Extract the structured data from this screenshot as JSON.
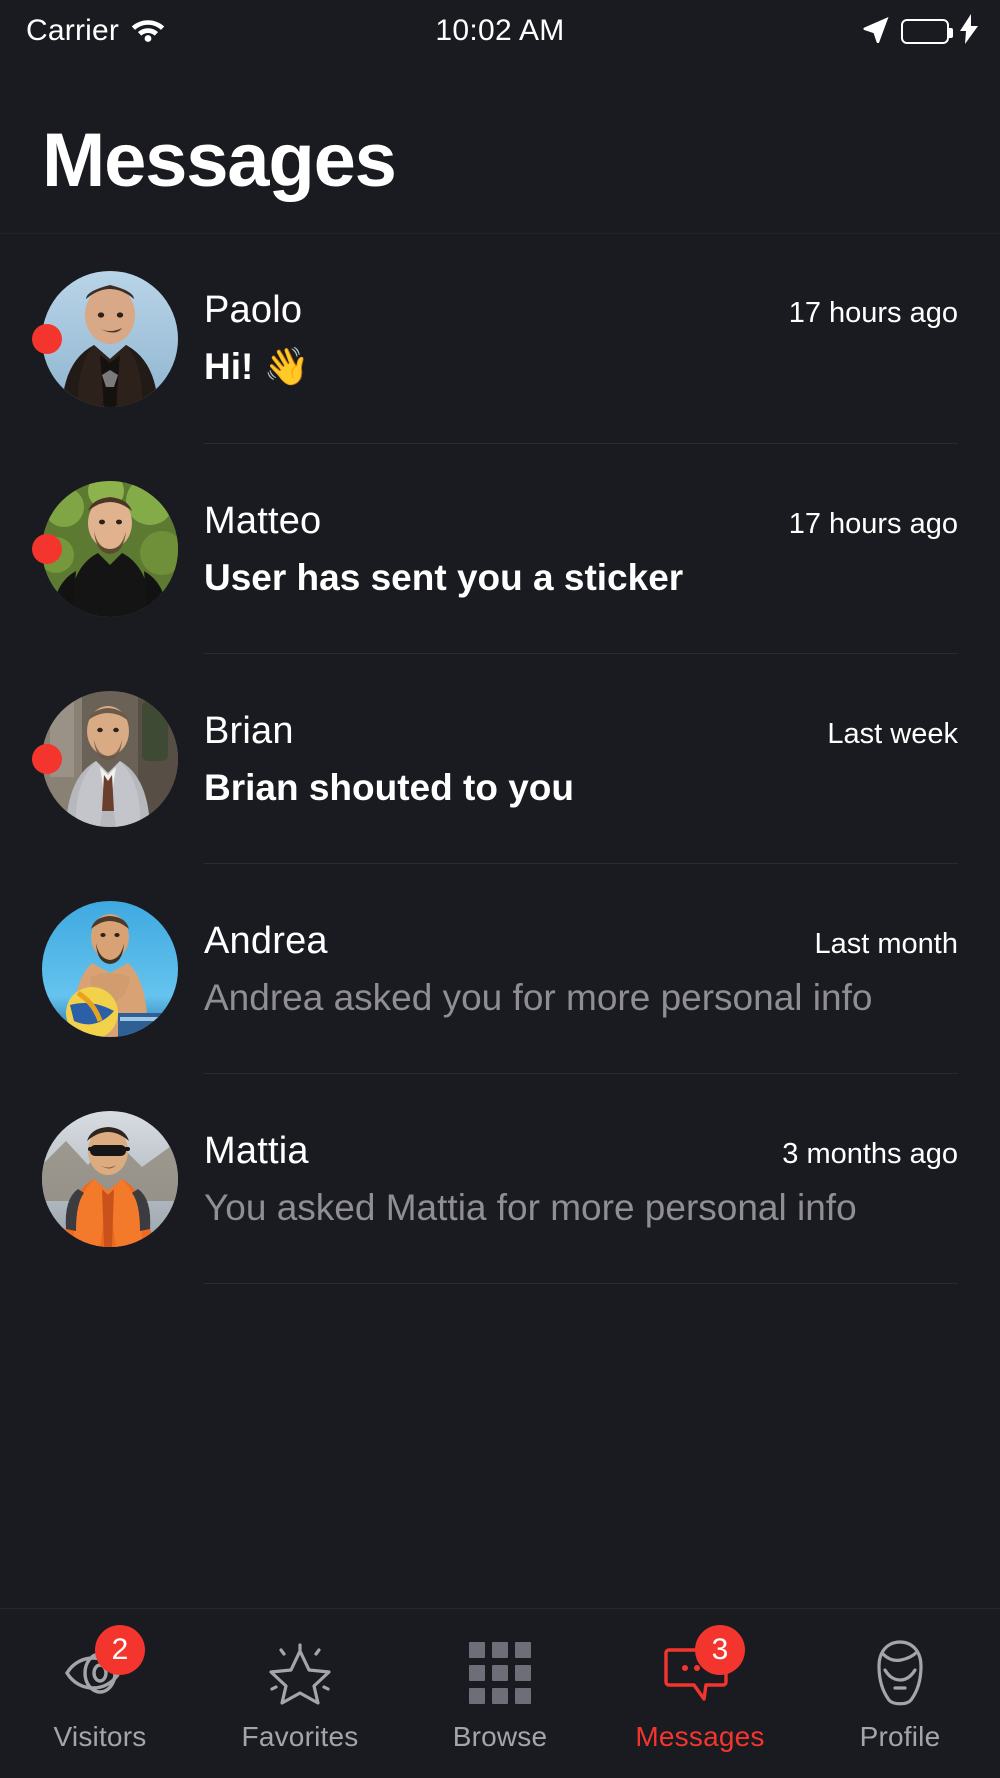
{
  "statusbar": {
    "carrier": "Carrier",
    "time": "10:02 AM",
    "wifi_icon": "wifi-icon",
    "location_icon": "location-arrow-icon",
    "battery_icon": "battery-icon",
    "charging_icon": "lightning-bolt-icon",
    "battery_color": "#4cd964"
  },
  "header": {
    "title": "Messages"
  },
  "accent": {
    "red": "#f4352e",
    "muted": "#8e8e93"
  },
  "messages": [
    {
      "name": "Paolo",
      "preview": "Hi! 👋",
      "time": "17 hours ago",
      "unread": true,
      "avatar_name": "avatar-paolo"
    },
    {
      "name": "Matteo",
      "preview": "User has sent you a sticker",
      "time": "17 hours ago",
      "unread": true,
      "avatar_name": "avatar-matteo"
    },
    {
      "name": "Brian",
      "preview": "Brian shouted to you",
      "time": "Last week",
      "unread": true,
      "avatar_name": "avatar-brian"
    },
    {
      "name": "Andrea",
      "preview": "Andrea asked you for more personal info",
      "time": "Last month",
      "unread": false,
      "avatar_name": "avatar-andrea"
    },
    {
      "name": "Mattia",
      "preview": "You asked Mattia for more personal info",
      "time": "3 months ago",
      "unread": false,
      "avatar_name": "avatar-mattia"
    }
  ],
  "tabbar": {
    "items": [
      {
        "label": "Visitors",
        "icon": "eye-icon",
        "badge": "2",
        "active": false
      },
      {
        "label": "Favorites",
        "icon": "star-icon",
        "badge": null,
        "active": false
      },
      {
        "label": "Browse",
        "icon": "grid-icon",
        "badge": null,
        "active": false
      },
      {
        "label": "Messages",
        "icon": "chat-bubble-icon",
        "badge": "3",
        "active": true
      },
      {
        "label": "Profile",
        "icon": "person-head-icon",
        "badge": null,
        "active": false
      }
    ]
  }
}
